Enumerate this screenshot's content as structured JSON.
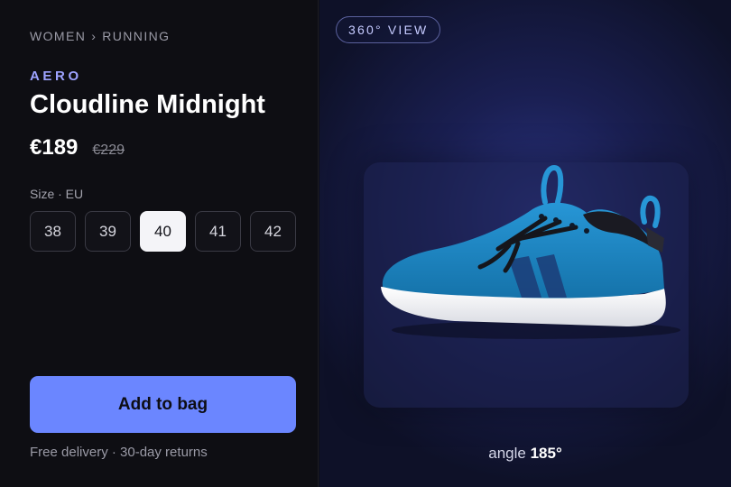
{
  "breadcrumb": {
    "category": "WOMEN",
    "separator": "›",
    "subcategory": "RUNNING"
  },
  "product": {
    "brand": "AERO",
    "name": "Cloudline Midnight",
    "price": "€189",
    "original_price": "€229"
  },
  "size": {
    "label": "Size · EU",
    "options": [
      "38",
      "39",
      "40",
      "41",
      "42"
    ],
    "selected": "40"
  },
  "cart": {
    "add_label": "Add to bag",
    "delivery_note": "Free delivery · 30-day returns"
  },
  "viewer": {
    "badge": "360° VIEW",
    "angle_label": "angle",
    "angle_value": "185°"
  },
  "colors": {
    "accent": "#6b86ff",
    "brand_text": "#9ea3ff",
    "shoe_upper": "#1f87c4",
    "shoe_sole": "#f2f2f4"
  }
}
